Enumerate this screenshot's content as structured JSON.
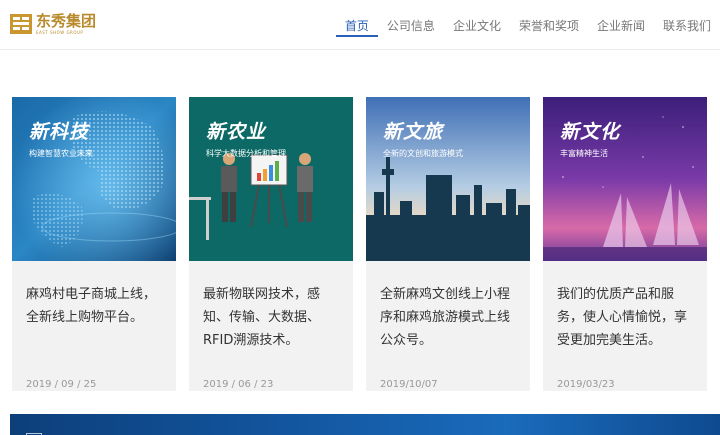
{
  "brand": {
    "name_cn": "东秀集团",
    "name_en": "EAST SHOW GROUP",
    "color": "#b88a2c"
  },
  "nav": {
    "items": [
      {
        "label": "首页",
        "active": true
      },
      {
        "label": "公司信息",
        "active": false
      },
      {
        "label": "企业文化",
        "active": false
      },
      {
        "label": "荣誉和奖项",
        "active": false
      },
      {
        "label": "企业新闻",
        "active": false
      },
      {
        "label": "联系我们",
        "active": false
      }
    ],
    "active_color": "#2a5fb5"
  },
  "cards": [
    {
      "title": "新科技",
      "subtitle": "构建智慧农业未来",
      "text": "麻鸡村电子商城上线，全新线上购物平台。",
      "date": "2019 / 09 / 25"
    },
    {
      "title": "新农业",
      "subtitle": "科学大数据分析和管理",
      "text": "最新物联网技术，感知、传输、大数据、RFID溯源技术。",
      "date": "2019 / 06 / 23"
    },
    {
      "title": "新文旅",
      "subtitle": "全新的文创和旅游模式",
      "text": "全新麻鸡文创线上小程序和麻鸡旅游模式上线公众号。",
      "date": "2019/10/07"
    },
    {
      "title": "新文化",
      "subtitle": "丰富精神生活",
      "text": "我们的优质产品和服务，使人心情愉悦，享受更加完美生活。",
      "date": "2019/03/23"
    }
  ]
}
